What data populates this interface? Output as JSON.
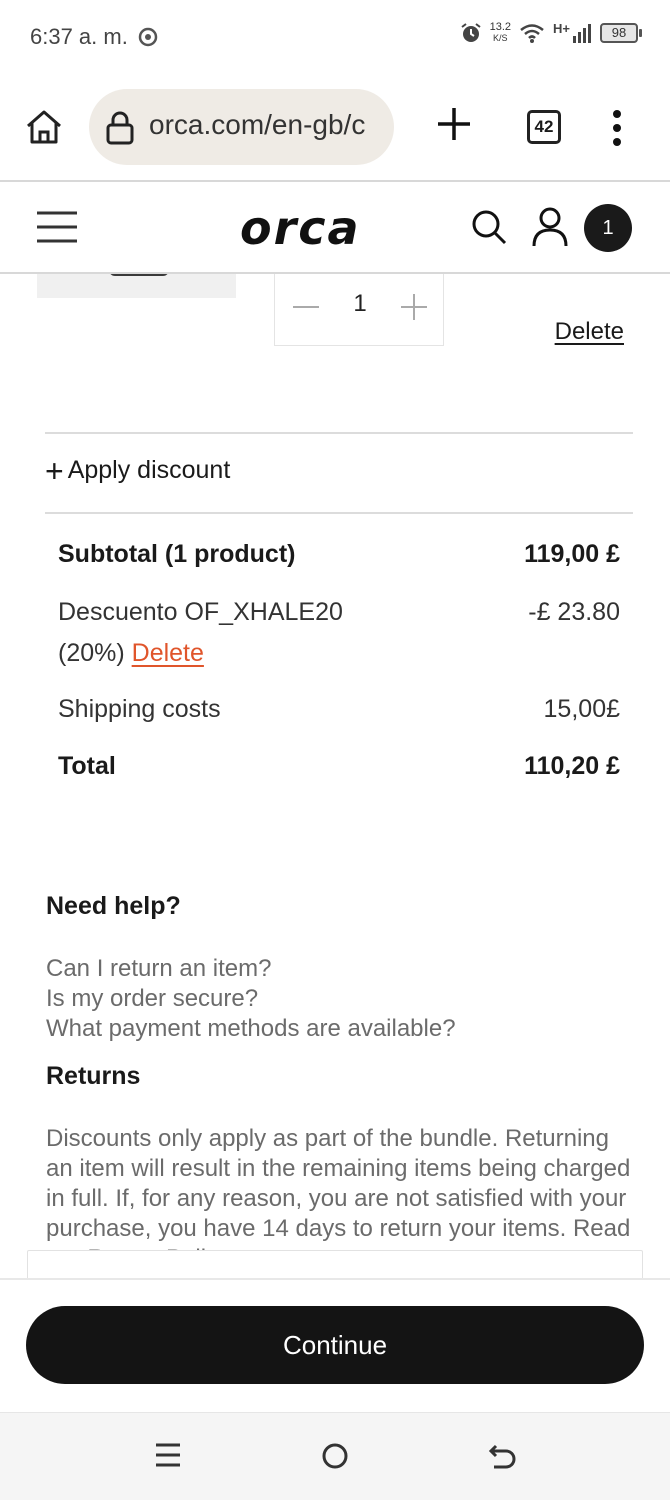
{
  "status_bar": {
    "time": "6:37 a. m.",
    "net_speed_value": "13.2",
    "net_speed_unit": "K/S",
    "network_type": "H+",
    "battery": "98"
  },
  "browser": {
    "url": "orca.com/en-gb/c",
    "tab_count": "42"
  },
  "site_header": {
    "logo_text": "orca",
    "cart_count": "1"
  },
  "cart_item": {
    "quantity": "1",
    "delete_label": "Delete"
  },
  "discount": {
    "apply_label": "Apply discount"
  },
  "summary": {
    "subtotal_label": "Subtotal (1 product)",
    "subtotal_value": "119,00 £",
    "discount_label_line1": "Descuento OF_XHALE20",
    "discount_label_line2": "(20%)",
    "discount_delete_label": "Delete",
    "discount_value": "-£ 23.80",
    "shipping_label": "Shipping costs",
    "shipping_value": "15,00£",
    "total_label": "Total",
    "total_value": "110,20 £"
  },
  "help": {
    "title": "Need help?",
    "links": [
      "Can I return an item?",
      "Is my order secure?",
      "What payment methods are available?"
    ],
    "returns_title": "Returns",
    "returns_text": "Discounts only apply as part of the bundle. Returning an item will result in the remaining items being charged in full. If, for any reason, you are not satisfied with your purchase, you have 14 days to return your items. Read our Return Policy"
  },
  "checkout": {
    "continue_label": "Continue"
  }
}
